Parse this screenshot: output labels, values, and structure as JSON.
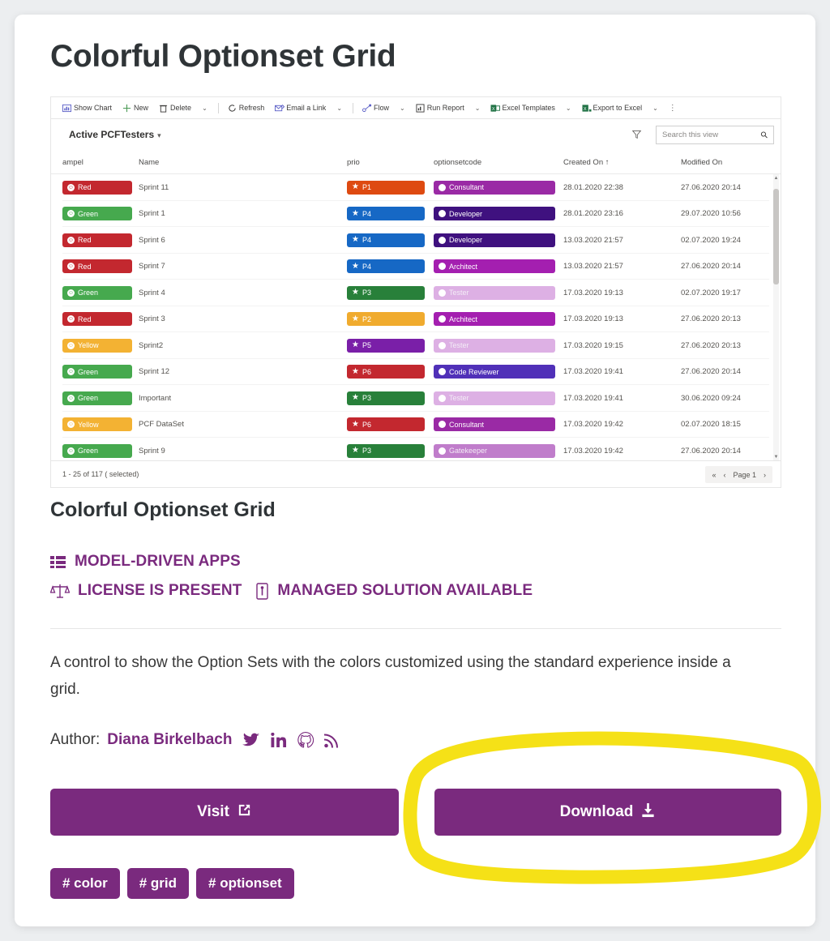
{
  "page": {
    "title": "Colorful Optionset Grid",
    "subtitle": "Colorful Optionset Grid",
    "description": "A control to show the Option Sets with the colors customized using the standard experience inside a grid.",
    "author_label": "Author:",
    "author_name": "Diana Birkelbach",
    "accent_color": "#7a2a7e",
    "highlight_color": "#f5e117"
  },
  "badges": [
    {
      "icon": "list-icon",
      "label": "MODEL-DRIVEN APPS"
    },
    {
      "icon": "scales-icon",
      "label": "LICENSE IS PRESENT"
    },
    {
      "icon": "document-icon",
      "label": "MANAGED SOLUTION AVAILABLE"
    }
  ],
  "social": [
    {
      "icon": "twitter-icon",
      "name": "twitter"
    },
    {
      "icon": "linkedin-icon",
      "name": "linkedin"
    },
    {
      "icon": "github-icon",
      "name": "github"
    },
    {
      "icon": "rss-icon",
      "name": "rss"
    }
  ],
  "buttons": {
    "visit": "Visit",
    "download": "Download"
  },
  "tags": [
    "# color",
    "# grid",
    "# optionset"
  ],
  "screenshot": {
    "toolbar": [
      {
        "label": "Show Chart",
        "icon": "chart-icon",
        "chevron": false
      },
      {
        "label": "New",
        "icon": "plus-icon",
        "chevron": false
      },
      {
        "label": "Delete",
        "icon": "trash-icon",
        "chevron": true
      },
      {
        "label": "Refresh",
        "icon": "refresh-icon",
        "chevron": false
      },
      {
        "label": "Email a Link",
        "icon": "email-icon",
        "chevron": true
      },
      {
        "label": "Flow",
        "icon": "flow-icon",
        "chevron": true
      },
      {
        "label": "Run Report",
        "icon": "report-icon",
        "chevron": true
      },
      {
        "label": "Excel Templates",
        "icon": "excel-icon",
        "chevron": true
      },
      {
        "label": "Export to Excel",
        "icon": "excel-export-icon",
        "chevron": true
      }
    ],
    "overflow": "⋮",
    "view_name": "Active PCFTesters",
    "search_placeholder": "Search this view",
    "columns": [
      "ampel",
      "Name",
      "prio",
      "optionsetcode",
      "Created On ↑",
      "Modified On"
    ],
    "rows": [
      {
        "ampel": "Red",
        "ampel_color": "#c3282f",
        "name": "Sprint 11",
        "prio": "P1",
        "prio_color": "#de4a11",
        "code": "Consultant",
        "code_color": "#9a2aa5",
        "code_muted": false,
        "created": "28.01.2020 22:38",
        "modified": "27.06.2020 20:14"
      },
      {
        "ampel": "Green",
        "ampel_color": "#46a94e",
        "name": "Sprint 1",
        "prio": "P4",
        "prio_color": "#1668c5",
        "code": "Developer",
        "code_color": "#3f117f",
        "code_muted": false,
        "created": "28.01.2020 23:16",
        "modified": "29.07.2020 10:56"
      },
      {
        "ampel": "Red",
        "ampel_color": "#c3282f",
        "name": "Sprint 6",
        "prio": "P4",
        "prio_color": "#1668c5",
        "code": "Developer",
        "code_color": "#3f117f",
        "code_muted": false,
        "created": "13.03.2020 21:57",
        "modified": "02.07.2020 19:24"
      },
      {
        "ampel": "Red",
        "ampel_color": "#c3282f",
        "name": "Sprint 7",
        "prio": "P4",
        "prio_color": "#1668c5",
        "code": "Architect",
        "code_color": "#a41fb0",
        "code_muted": false,
        "created": "13.03.2020 21:57",
        "modified": "27.06.2020 20:14"
      },
      {
        "ampel": "Green",
        "ampel_color": "#46a94e",
        "name": "Sprint 4",
        "prio": "P3",
        "prio_color": "#28803a",
        "code": "Tester",
        "code_color": "#ddb0e4",
        "code_muted": true,
        "created": "17.03.2020 19:13",
        "modified": "02.07.2020 19:17"
      },
      {
        "ampel": "Red",
        "ampel_color": "#c3282f",
        "name": "Sprint 3",
        "prio": "P2",
        "prio_color": "#f0ab2e",
        "code": "Architect",
        "code_color": "#a41fb0",
        "code_muted": false,
        "created": "17.03.2020 19:13",
        "modified": "27.06.2020 20:13"
      },
      {
        "ampel": "Yellow",
        "ampel_color": "#f3b233",
        "name": "Sprint2",
        "prio": "P5",
        "prio_color": "#7a1fa8",
        "code": "Tester",
        "code_color": "#ddb0e4",
        "code_muted": true,
        "created": "17.03.2020 19:15",
        "modified": "27.06.2020 20:13"
      },
      {
        "ampel": "Green",
        "ampel_color": "#46a94e",
        "name": "Sprint 12",
        "prio": "P6",
        "prio_color": "#c3282f",
        "code": "Code Reviewer",
        "code_color": "#5030b8",
        "code_muted": false,
        "created": "17.03.2020 19:41",
        "modified": "27.06.2020 20:14"
      },
      {
        "ampel": "Green",
        "ampel_color": "#46a94e",
        "name": "Important",
        "prio": "P3",
        "prio_color": "#28803a",
        "code": "Tester",
        "code_color": "#ddb0e4",
        "code_muted": true,
        "created": "17.03.2020 19:41",
        "modified": "30.06.2020 09:24"
      },
      {
        "ampel": "Yellow",
        "ampel_color": "#f3b233",
        "name": "PCF DataSet",
        "prio": "P6",
        "prio_color": "#c3282f",
        "code": "Consultant",
        "code_color": "#9a2aa5",
        "code_muted": false,
        "created": "17.03.2020 19:42",
        "modified": "02.07.2020 18:15"
      },
      {
        "ampel": "Green",
        "ampel_color": "#46a94e",
        "name": "Sprint 9",
        "prio": "P3",
        "prio_color": "#28803a",
        "code": "Gatekeeper",
        "code_color": "#c07dcb",
        "code_muted": true,
        "created": "17.03.2020 19:42",
        "modified": "27.06.2020 20:14"
      }
    ],
    "footer_count": "1 - 25 of 117 ( selected)",
    "pagination": {
      "first": "«",
      "prev": "‹",
      "page_label": "Page 1",
      "next": "›"
    }
  }
}
